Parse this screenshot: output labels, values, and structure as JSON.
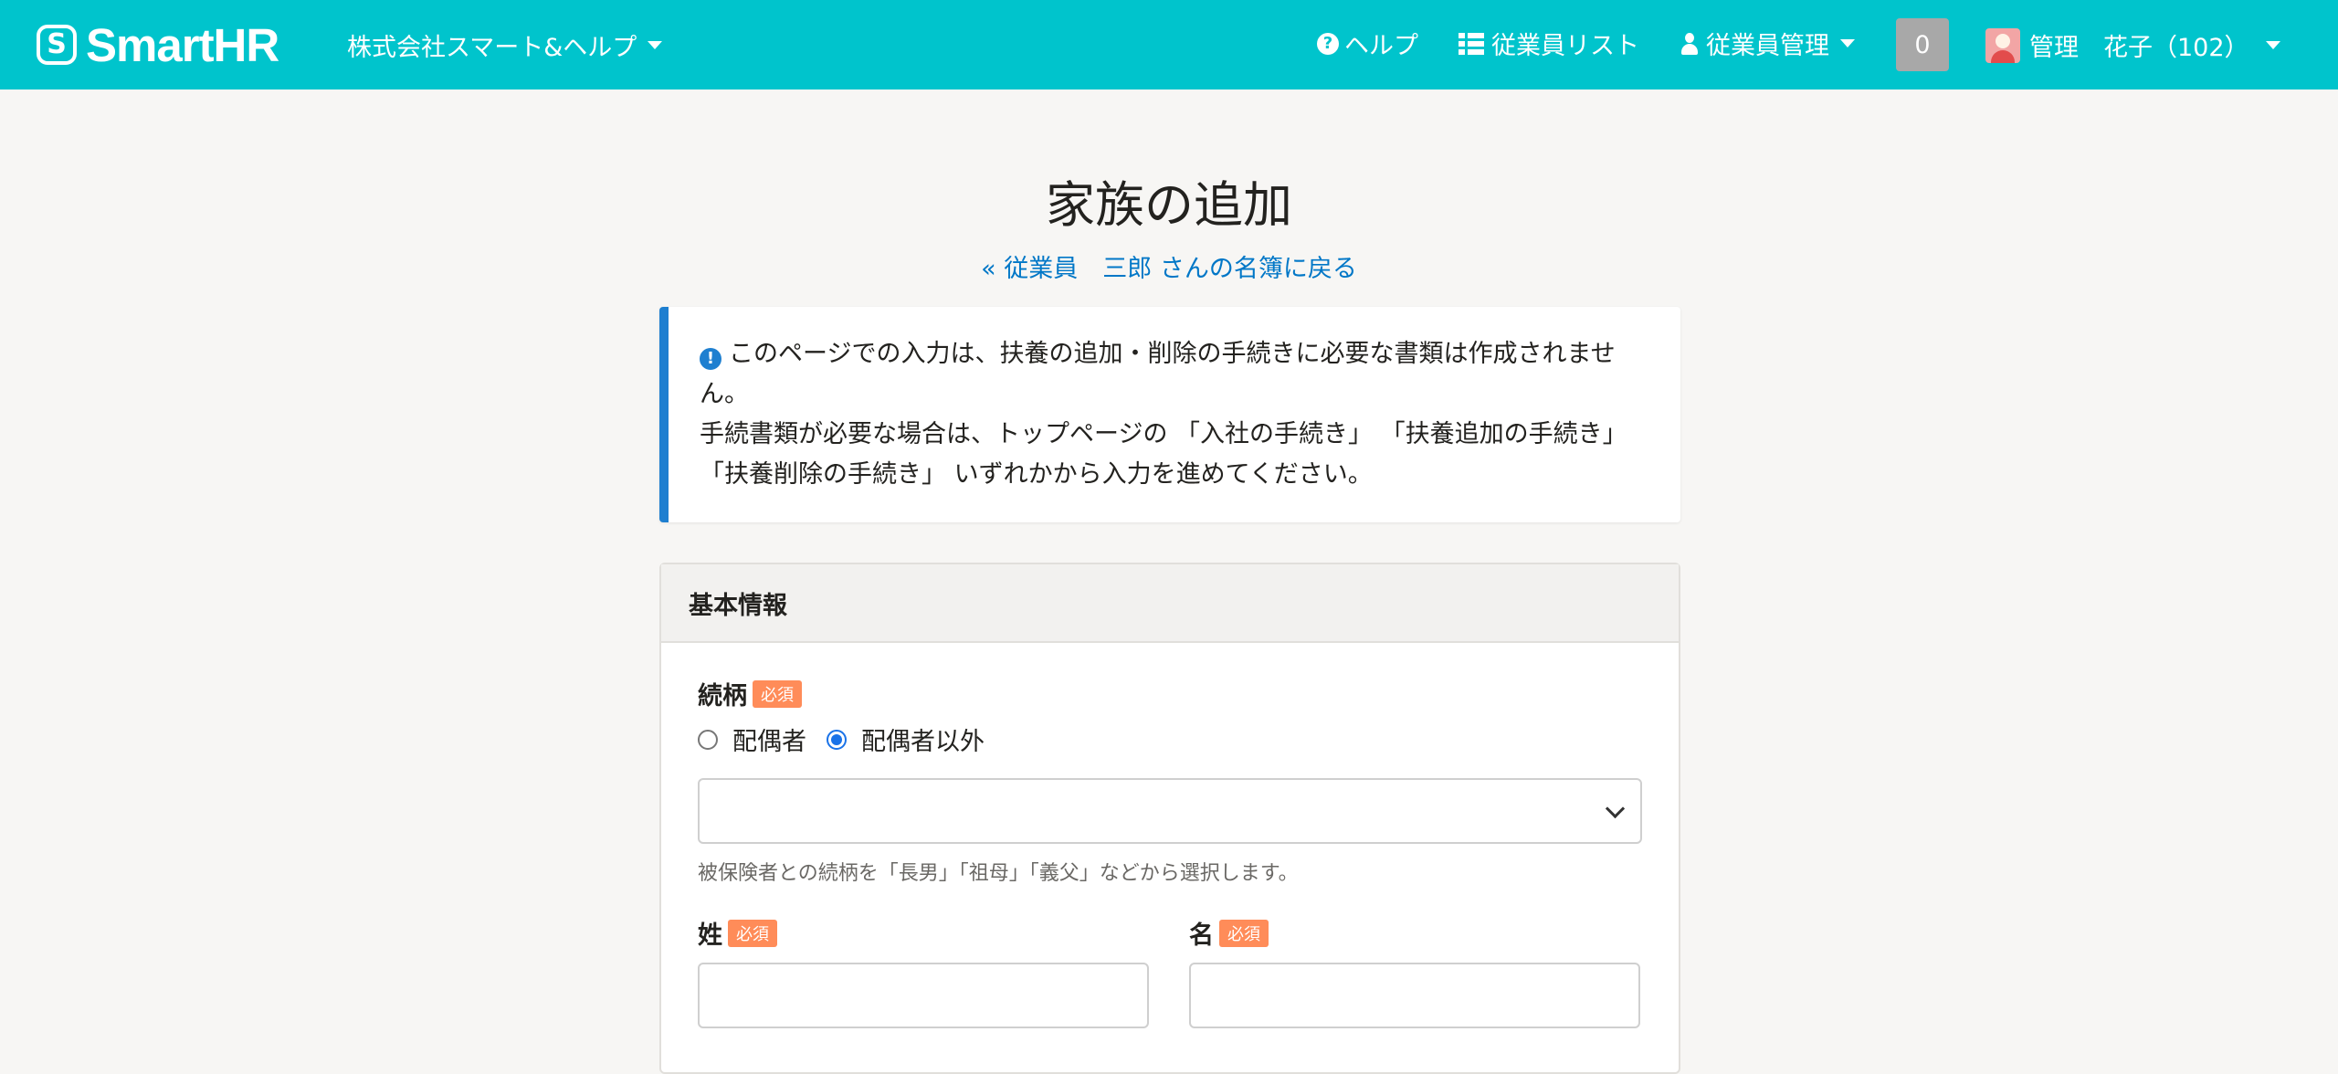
{
  "header": {
    "brand": "SmartHR",
    "company": "株式会社スマート&ヘルプ",
    "nav": {
      "help": "ヘルプ",
      "employee_list": "従業員リスト",
      "employee_management": "従業員管理"
    },
    "notification_count": "0",
    "user_name": "管理　花子（102）"
  },
  "page": {
    "title": "家族の追加",
    "back_link": "« 従業員　三郎 さんの名簿に戻る"
  },
  "notice": {
    "line1": "このページでの入力は、扶養の追加・削除の手続きに必要な書類は作成されません。",
    "line2": "手続書類が必要な場合は、トップページの 「入社の手続き」 「扶養追加の手続き」 「扶養削除の手続き」 いずれかから入力を進めてください。"
  },
  "form": {
    "section_title": "基本情報",
    "required_badge": "必須",
    "relationship": {
      "label": "続柄",
      "options": [
        "配偶者",
        "配偶者以外"
      ],
      "selected": "配偶者以外",
      "select_value": "",
      "hint": "被保険者との続柄を「長男」「祖母」「義父」などから選択します。"
    },
    "last_name": {
      "label": "姓",
      "value": ""
    },
    "first_name": {
      "label": "名",
      "value": ""
    }
  },
  "colors": {
    "header_bg": "#00c4cc",
    "link": "#0077c7",
    "notice_accent": "#1e7fd0",
    "required_badge": "#ff8c59"
  }
}
